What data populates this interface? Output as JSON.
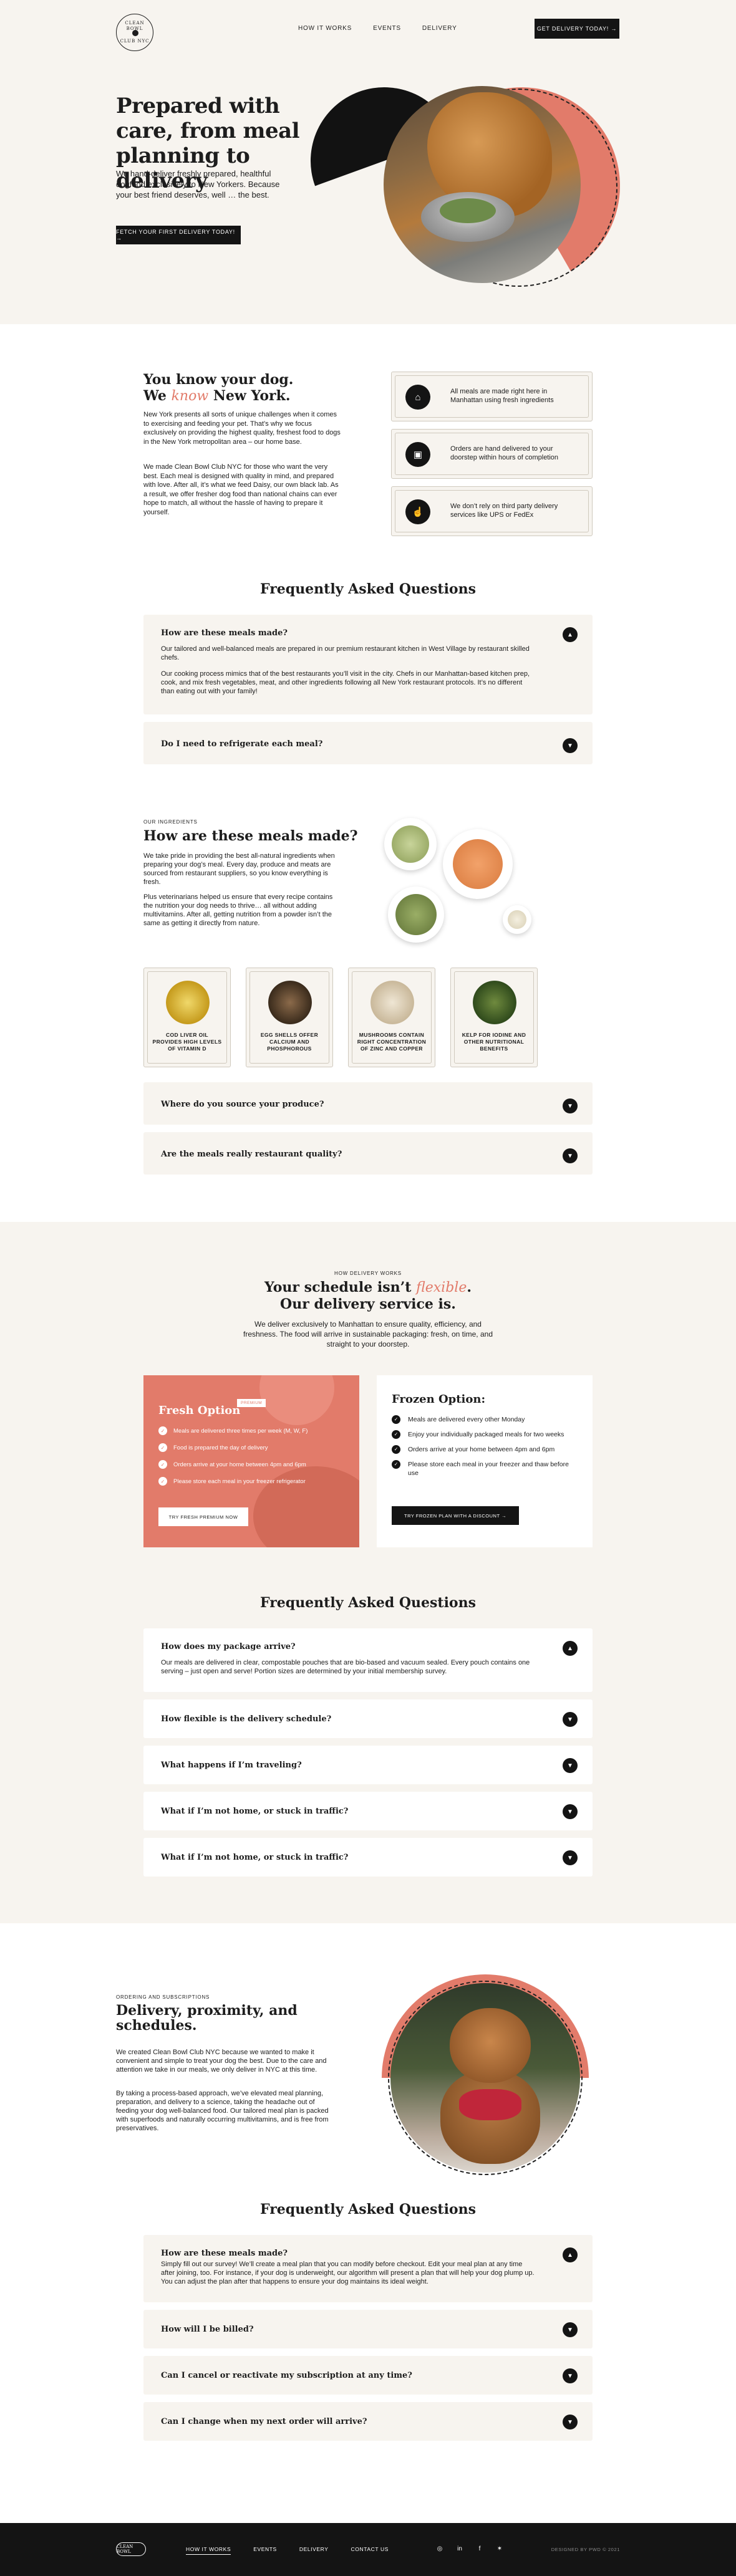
{
  "nav": {
    "logo_line1": "CLEAN BOWL",
    "logo_line2": "CLUB NYC",
    "links": [
      "HOW IT WORKS",
      "EVENTS",
      "DELIVERY"
    ],
    "cta": "GET DELIVERY TODAY! →"
  },
  "hero": {
    "title": "Prepared with care, from meal planning to delivery",
    "description": "We hand-deliver freshly prepared, healthful dogfood exclusively to New Yorkers. Because your best friend deserves, well … the best.",
    "button": "FETCH YOUR FIRST DELIVERY TODAY! →"
  },
  "know": {
    "title_a": "You know your dog.",
    "title_b_pre": "We ",
    "title_b_em": "know",
    "title_b_post": " New York.",
    "p1": "New York presents all sorts of unique challenges when it comes to exercising and feeding your pet. That’s why we focus exclusively on providing the highest quality, freshest food to dogs in the New York metropolitan area – our home base.",
    "p2": "We made Clean Bowl Club NYC for those who want the very best. Each meal is designed with quality in mind, and prepared with love. After all, it’s what we feed Daisy, our own black lab. As a result, we offer fresher dog food than national chains can ever hope to match, all without the hassle of having to prepare it yourself.",
    "features": [
      {
        "icon": "building-icon",
        "glyph": "⌂",
        "text": "All meals are made right here in Manhattan using fresh ingredients"
      },
      {
        "icon": "delivery-box-icon",
        "glyph": "▣",
        "text": "Orders are hand delivered to your doorstep within hours of completion"
      },
      {
        "icon": "thumbs-up-icon",
        "glyph": "☝",
        "text": "We don’t rely on third party delivery services like UPS or FedEx"
      }
    ]
  },
  "faq1": {
    "title": "Frequently Asked Questions",
    "items": [
      {
        "q": "How are these meals made?",
        "a1": "Our tailored and well-balanced meals are prepared in our premium restaurant kitchen in West Village by restaurant skilled chefs.",
        "a2": "Our cooking process mimics that of the best restaurants you’ll visit in the city. Chefs in our Manhattan-based kitchen prep, cook, and mix fresh vegetables, meat, and other ingredients following all New York restaurant protocols. It’s no different than eating out with your family!"
      },
      {
        "q": "Do I need to refrigerate each meal?"
      }
    ]
  },
  "ingredients": {
    "eyebrow": "OUR INGREDIENTS",
    "title": "How are these meals made?",
    "p1": "We take pride in providing the best all-natural ingredients when preparing your dog’s meal. Every day, produce and meats are sourced from restaurant suppliers, so you know everything is fresh.",
    "p2": "Plus veterinarians helped us ensure that every recipe contains the nutrition your dog needs to thrive… all without adding multivitamins. After all, getting nutrition from a powder isn’t the same as getting it directly from nature.",
    "cards": [
      {
        "icon": "cod-liver-oil-icon",
        "caption": "COD LIVER OIL PROVIDES HIGH LEVELS OF VITAMIN D"
      },
      {
        "icon": "egg-shells-icon",
        "caption": "EGG SHELLS OFFER CALCIUM AND PHOSPHOROUS"
      },
      {
        "icon": "mushrooms-icon",
        "caption": "MUSHROOMS CONTAIN RIGHT CONCENTRATION OF ZINC AND COPPER"
      },
      {
        "icon": "kelp-icon",
        "caption": "KELP FOR IODINE AND OTHER NUTRITIONAL BENEFITS"
      }
    ],
    "faqs": [
      "Where do you source your produce?",
      "Are the meals really restaurant quality?"
    ]
  },
  "delivery": {
    "eyebrow": "HOW DELIVERY WORKS",
    "title_a_pre": "Your schedule isn’t ",
    "title_a_em": "flexible",
    "title_a_post": ".",
    "title_b": "Our delivery service is.",
    "description": "We deliver exclusively to Manhattan to ensure quality, efficiency, and freshness. The food will arrive in sustainable packaging: fresh, on time, and straight to your doorstep.",
    "fresh": {
      "title": "Fresh Option",
      "badge": "PREMIUM",
      "items": [
        "Meals are delivered three times per week (M, W, F)",
        "Food is prepared the day of delivery",
        "Orders arrive at your home between 4pm and 6pm",
        "Please store each meal in your freezer refrigerator"
      ],
      "button": "TRY FRESH PREMIUM NOW"
    },
    "frozen": {
      "title": "Frozen Option:",
      "items": [
        "Meals are delivered every other Monday",
        "Enjoy your individually packaged meals for two weeks",
        "Orders arrive at your home between 4pm and 6pm",
        "Please store each meal in your freezer and thaw before use"
      ],
      "button": "TRY FROZEN PLAN WITH A DISCOUNT →"
    }
  },
  "faq2": {
    "title": "Frequently Asked Questions",
    "items": [
      {
        "q": "How does my package arrive?",
        "a": "Our meals are delivered in clear, compostable pouches that are bio-based and vacuum sealed. Every pouch contains one serving – just open and serve! Portion sizes are determined by your initial membership survey."
      },
      {
        "q": "How flexible is the delivery schedule?"
      },
      {
        "q": "What happens if I’m traveling?"
      },
      {
        "q": "What if I’m not home, or stuck in traffic?"
      },
      {
        "q": "What if I’m not home, or stuck in traffic?"
      }
    ]
  },
  "ordering": {
    "eyebrow": "ORDERING AND SUBSCRIPTIONS",
    "title": "Delivery, proximity, and schedules.",
    "p1": "We created Clean Bowl Club NYC because we wanted to make it convenient and simple to treat your dog the best. Due to the care and attention we take in our meals, we only deliver in NYC at this time.",
    "p2": "By taking a process-based approach, we’ve elevated meal planning, preparation, and delivery to a science, taking the headache out of feeding your dog well-balanced food. Our tailored meal plan is packed with superfoods and naturally occurring multivitamins, and is free from preservatives."
  },
  "faq3": {
    "title": "Frequently Asked Questions",
    "items": [
      {
        "q": "How are these meals made?",
        "a": "Simply fill out our survey! We’ll create a meal plan that you can modify before checkout. Edit your meal plan at any time after joining, too. For instance, if your dog is underweight, our algorithm will present a plan that will help your dog plump up. You can adjust the plan after that happens to ensure your dog maintains its ideal weight."
      },
      {
        "q": "How will I be billed?"
      },
      {
        "q": "Can I cancel or reactivate my subscription at any time?"
      },
      {
        "q": "Can I change when my next order will arrive?"
      }
    ]
  },
  "footer": {
    "logo": "CLEAN BOWL",
    "links": [
      "HOW IT WORKS",
      "EVENTS",
      "DELIVERY",
      "CONTACT US"
    ],
    "social": [
      {
        "icon": "instagram-icon",
        "glyph": "◎"
      },
      {
        "icon": "linkedin-icon",
        "glyph": "in"
      },
      {
        "icon": "facebook-icon",
        "glyph": "f"
      },
      {
        "icon": "twitter-icon",
        "glyph": "✶"
      }
    ],
    "credit": "DESIGNED BY PWD © 2021"
  },
  "colors": {
    "cream": "#f7f4ef",
    "salmon": "#e27b6a",
    "dark": "#141414"
  }
}
